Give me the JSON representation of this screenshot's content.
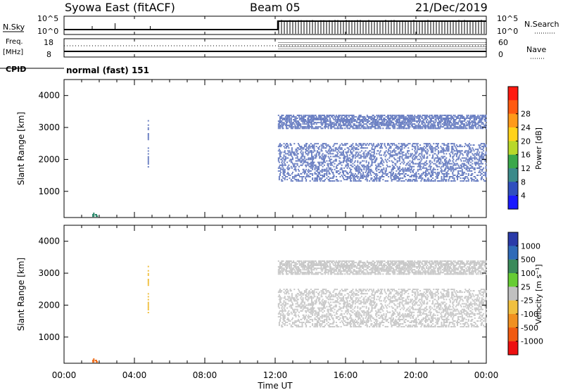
{
  "header": {
    "station": "Syowa East (fitACF)",
    "beam": "Beam 05",
    "date": "21/Dec/2019"
  },
  "side_labels": {
    "nsky": "N.Sky",
    "freq_line1": "Freq.",
    "freq_line2": "[MHz]",
    "cpid": "CPID",
    "nsearch": "N.Search",
    "nave": "Nave",
    "cpid_value": "normal (fast) 151"
  },
  "noise_panel": {
    "left_top": "10^5",
    "left_bottom": "10^0",
    "right_top": "10^5",
    "right_bottom": "10^0"
  },
  "freq_panel": {
    "left_ticks": [
      "18",
      "8"
    ],
    "right_ticks": [
      "60",
      "0"
    ]
  },
  "chart_data": [
    {
      "type": "heatmap",
      "name": "power",
      "ylabel": "Slant Range [km]",
      "xlabel": "",
      "ylim": [
        180,
        4500
      ],
      "yticks": [
        "1000",
        "2000",
        "3000",
        "4000"
      ],
      "colorbar": {
        "label": "Power [dB]",
        "ticks": [
          "4",
          "8",
          "12",
          "16",
          "20",
          "24",
          "28"
        ],
        "colors": [
          "#1a1aff",
          "#2f4fbf",
          "#3b8a8a",
          "#3aa84a",
          "#b8d82a",
          "#ffd21a",
          "#ff9a1a",
          "#ff5a10",
          "#ff1a10"
        ]
      },
      "regions": [
        {
          "x0": 12.15,
          "x1": 23.95,
          "y0": 2950,
          "y1": 3400,
          "color": "#6a7fc2"
        },
        {
          "x0": 12.15,
          "x1": 23.95,
          "y0": 1300,
          "y1": 2500,
          "color": "#6a7fc2"
        },
        {
          "x0": 4.75,
          "x1": 4.8,
          "y0": 1700,
          "y1": 3300,
          "color": "#6a7fc2"
        },
        {
          "x0": 1.6,
          "x1": 1.9,
          "y0": 200,
          "y1": 300,
          "color": "#2e8a6e"
        }
      ]
    },
    {
      "type": "heatmap",
      "name": "velocity",
      "ylabel": "Slant Range [km]",
      "xlabel": "Time UT",
      "ylim": [
        180,
        4500
      ],
      "yticks": [
        "1000",
        "2000",
        "3000",
        "4000"
      ],
      "xticks": [
        "00:00",
        "04:00",
        "08:00",
        "12:00",
        "16:00",
        "20:00",
        "00:00"
      ],
      "colorbar": {
        "label": "Velocity [m s⁻¹]",
        "ticks": [
          "1000",
          "500",
          "100",
          "25",
          "-25",
          "-100",
          "-500",
          "-1000"
        ],
        "colors": [
          "#2a3aa8",
          "#2f6ab8",
          "#3a8a5a",
          "#66cc33",
          "#c0c0c0",
          "#f0c040",
          "#f09020",
          "#f05a10",
          "#ee1010"
        ]
      },
      "regions": [
        {
          "x0": 12.15,
          "x1": 23.95,
          "y0": 2950,
          "y1": 3400,
          "color": "#c8c8c8"
        },
        {
          "x0": 12.15,
          "x1": 23.95,
          "y0": 1300,
          "y1": 2500,
          "color": "#c8c8c8"
        },
        {
          "x0": 4.75,
          "x1": 4.8,
          "y0": 1700,
          "y1": 3300,
          "color": "#f0c040"
        },
        {
          "x0": 1.6,
          "x1": 1.9,
          "y0": 200,
          "y1": 300,
          "color": "#ee7020"
        }
      ]
    }
  ]
}
